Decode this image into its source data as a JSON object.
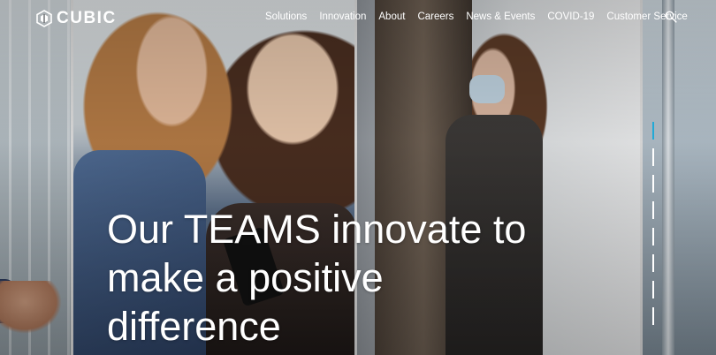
{
  "header": {
    "logo_text": "CUBIC",
    "nav": [
      "Solutions",
      "Innovation",
      "About",
      "Careers",
      "News & Events",
      "COVID-19",
      "Customer Service"
    ],
    "search_icon": "search-icon"
  },
  "hero": {
    "line1": "Our TEAMS innovate to",
    "line2": "make a positive",
    "line3": "difference"
  },
  "slider": {
    "total": 8,
    "active_index": 0,
    "active_color": "#22a9d6",
    "inactive_color": "#ffffff"
  },
  "colors": {
    "text": "#ffffff",
    "accent": "#22a9d6"
  }
}
